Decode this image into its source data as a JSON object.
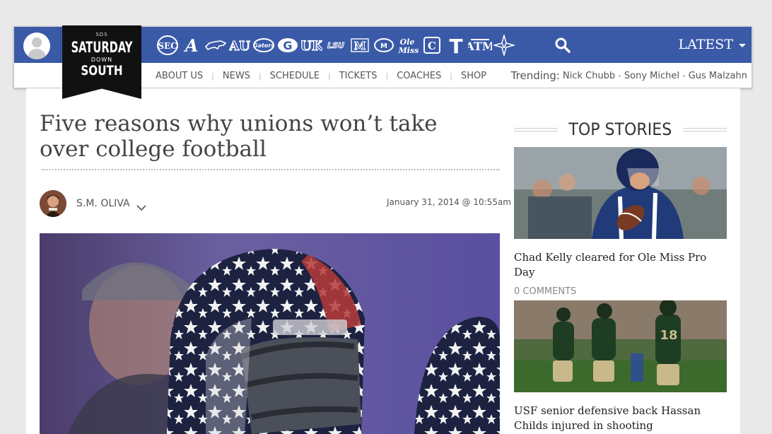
{
  "brand": {
    "top": "SDS",
    "line1": "SATURDAY",
    "line2": "DOWN",
    "line3": "SOUTH"
  },
  "teams": [
    {
      "icon": "sec-icon",
      "glyph": "SEC"
    },
    {
      "icon": "alabama-icon",
      "glyph": "A"
    },
    {
      "icon": "arkansas-icon",
      "glyph": ""
    },
    {
      "icon": "auburn-icon",
      "glyph": "AU"
    },
    {
      "icon": "florida-icon",
      "glyph": "Gators"
    },
    {
      "icon": "georgia-icon",
      "glyph": "G"
    },
    {
      "icon": "kentucky-icon",
      "glyph": "UK"
    },
    {
      "icon": "lsu-icon",
      "glyph": "LSU"
    },
    {
      "icon": "mississippi-state-icon",
      "glyph": "M"
    },
    {
      "icon": "missouri-icon",
      "glyph": "M"
    },
    {
      "icon": "ole-miss-icon",
      "glyph": "Ole Miss"
    },
    {
      "icon": "south-carolina-icon",
      "glyph": "C"
    },
    {
      "icon": "tennessee-icon",
      "glyph": "T"
    },
    {
      "icon": "texas-am-icon",
      "glyph": "ATM"
    },
    {
      "icon": "vanderbilt-icon",
      "glyph": "V"
    }
  ],
  "latest_label": "LATEST",
  "nav": [
    "ABOUT US",
    "NEWS",
    "SCHEDULE",
    "TICKETS",
    "COACHES",
    "SHOP"
  ],
  "trending": {
    "label": "Trending:",
    "items": [
      "Nick Chubb",
      "Sony Michel",
      "Gus Malzahn"
    ]
  },
  "article": {
    "title": "Five reasons why unions won’t take over college football",
    "author": "S.M. OLIVA",
    "date": "January 31, 2014 @ 10:55am"
  },
  "top_stories": {
    "heading": "TOP STORIES",
    "stories": [
      {
        "title": "Chad Kelly cleared for Ole Miss Pro Day",
        "comments": "0 COMMENTS"
      },
      {
        "title": "USF senior defensive back Hassan Childs injured in shooting",
        "comments": ""
      }
    ]
  },
  "colors": {
    "header_blue": "#3a5aa8",
    "logo_black": "#111111"
  }
}
